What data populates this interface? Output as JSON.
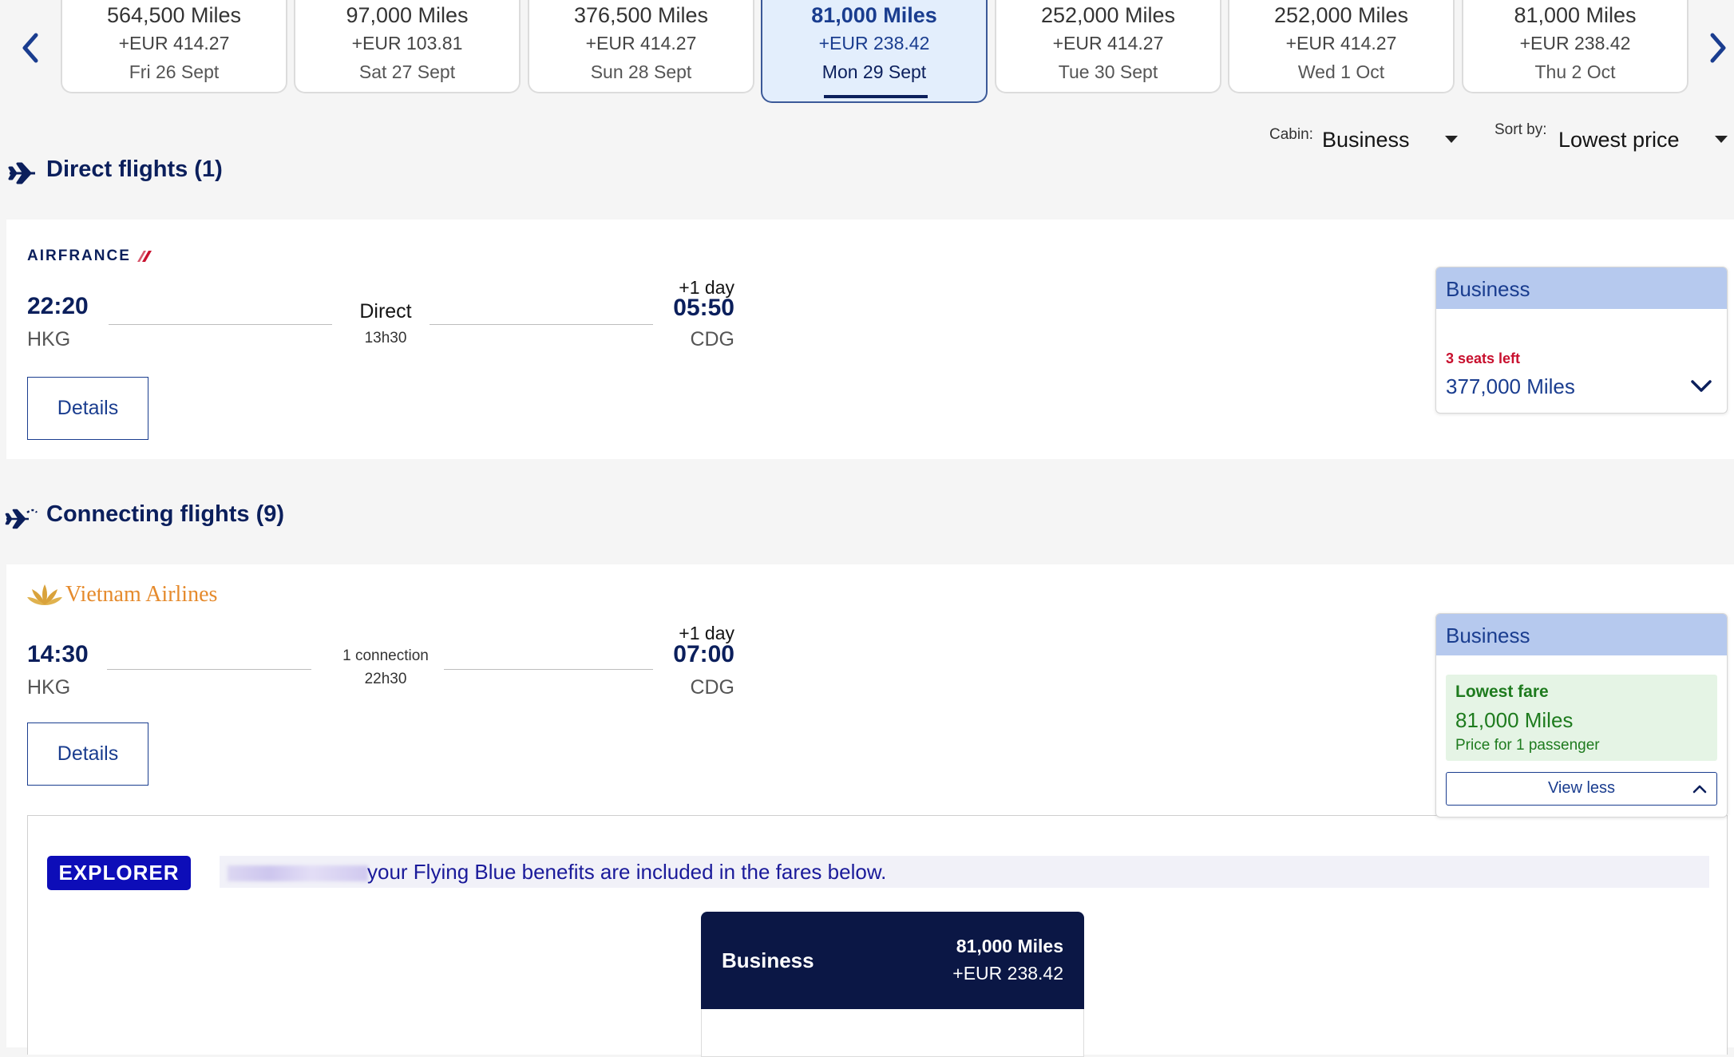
{
  "date_strip": {
    "cards": [
      {
        "miles": "564,500 Miles",
        "eur": "+EUR 414.27",
        "date": "Fri 26 Sept"
      },
      {
        "miles": "97,000 Miles",
        "eur": "+EUR 103.81",
        "date": "Sat 27 Sept"
      },
      {
        "miles": "376,500 Miles",
        "eur": "+EUR 414.27",
        "date": "Sun 28 Sept"
      },
      {
        "miles": "81,000 Miles",
        "eur": "+EUR 238.42",
        "date": "Mon 29 Sept"
      },
      {
        "miles": "252,000 Miles",
        "eur": "+EUR 414.27",
        "date": "Tue 30 Sept"
      },
      {
        "miles": "252,000 Miles",
        "eur": "+EUR 414.27",
        "date": "Wed 1 Oct"
      },
      {
        "miles": "81,000 Miles",
        "eur": "+EUR 238.42",
        "date": "Thu 2 Oct"
      }
    ]
  },
  "controls": {
    "cabin_label": "Cabin:",
    "cabin_value": "Business",
    "sort_label": "Sort by:",
    "sort_value": "Lowest price"
  },
  "direct": {
    "title": "Direct flights (1)",
    "flight": {
      "airline": "AIRFRANCE",
      "dep_time": "22:20",
      "dep_airport": "HKG",
      "stops": "Direct",
      "duration": "13h30",
      "day_offset": "+1 day",
      "arr_time": "05:50",
      "arr_airport": "CDG",
      "details_label": "Details",
      "fare": {
        "cabin": "Business",
        "seats": "3 seats left",
        "miles": "377,000 Miles"
      }
    }
  },
  "connecting": {
    "title": "Connecting flights (9)",
    "flight": {
      "airline": "Vietnam Airlines",
      "dep_time": "14:30",
      "dep_airport": "HKG",
      "stops": "1 connection",
      "duration": "22h30",
      "day_offset": "+1 day",
      "arr_time": "07:00",
      "arr_airport": "CDG",
      "details_label": "Details",
      "fare": {
        "cabin": "Business",
        "tag": "Lowest fare",
        "miles": "81,000 Miles",
        "note": "Price for 1 passenger",
        "view_less": "View less"
      }
    },
    "explorer": {
      "badge": "EXPLORER",
      "message": "your Flying Blue benefits are included in the fares below."
    },
    "fare_card": {
      "cabin": "Business",
      "miles": "81,000 Miles",
      "eur": "+EUR 238.42"
    }
  },
  "colors": {
    "brand_navy": "#0b1f5c",
    "link_blue": "#1a3d8f",
    "fare_header": "#b6c9ee",
    "alert_red": "#c8102e",
    "success_green": "#1e7b1e",
    "explorer_blue": "#0d0db8"
  }
}
